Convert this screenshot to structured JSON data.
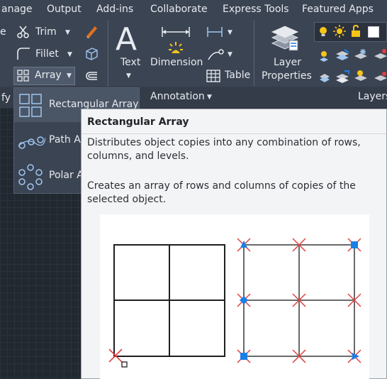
{
  "menu": {
    "items": [
      "anage",
      "Output",
      "Add-ins",
      "Collaborate",
      "Express Tools",
      "Featured Apps"
    ]
  },
  "ribbon": {
    "modify": {
      "partial_label": "e",
      "trim_label": "Trim",
      "fillet_label": "Fillet",
      "array_label": "Array",
      "panel_partial": "fy"
    },
    "annotation": {
      "text_label": "Text",
      "dimension_label": "Dimension",
      "table_label": "Table",
      "panel_label": "Annotation"
    },
    "layers": {
      "layer_properties_line1": "Layer",
      "layer_properties_line2": "Properties",
      "panel_label": "Layers"
    }
  },
  "array_dropdown": {
    "items": [
      {
        "label": "Rectangular Array",
        "icon": "rectangular-array-icon"
      },
      {
        "label": "Path Array",
        "icon": "path-array-icon"
      },
      {
        "label": "Polar Array",
        "icon": "polar-array-icon"
      }
    ]
  },
  "tooltip": {
    "title": "Rectangular Array",
    "description": "Distributes object copies into any combination of rows, columns, and levels.",
    "detail": "Creates an array of rows and columns of copies of the selected object."
  },
  "colors": {
    "ribbon_bg": "#3b4453",
    "canvas_bg": "#212830",
    "tooltip_bg": "#f3f4f6",
    "grip_blue": "#1a7fe6",
    "grip_red": "#e04040",
    "bulb_yellow": "#f5c518"
  }
}
